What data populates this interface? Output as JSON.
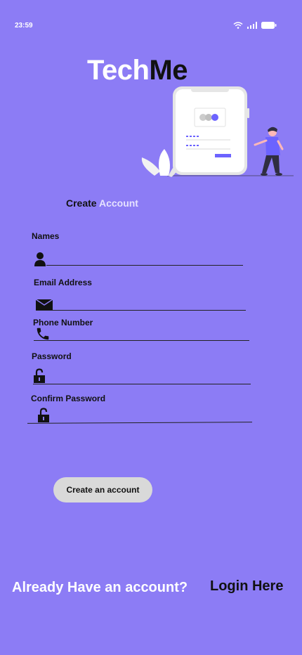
{
  "status_bar": {
    "time": "23:59"
  },
  "brand": {
    "part1": "Tech",
    "part2": "Me"
  },
  "heading": {
    "create": "Create",
    "account": "Account"
  },
  "fields": [
    {
      "label": "Names",
      "icon": "person-icon"
    },
    {
      "label": "Email Address",
      "icon": "envelope-icon"
    },
    {
      "label": "Phone Number",
      "icon": "phone-icon"
    },
    {
      "label": "Password",
      "icon": "lock-open-icon"
    },
    {
      "label": "Confirm Password",
      "icon": "lock-open-icon"
    }
  ],
  "submit": {
    "label": "Create an account"
  },
  "footer": {
    "prompt": "Already Have an account?",
    "link": "Login Here"
  },
  "colors": {
    "background": "#8c7cf5",
    "accent": "#6c63ff",
    "button": "#d9d9d9"
  }
}
